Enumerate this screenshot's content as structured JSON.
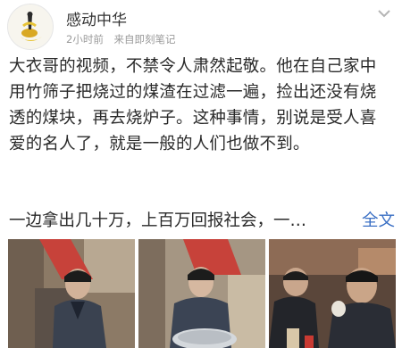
{
  "post": {
    "author": "感动中华",
    "time": "2小时前",
    "source": "来自即刻笔记",
    "paragraph": "大衣哥的视频，不禁令人肃然起敬。他在自己家中用竹筛子把烧过的煤渣在过滤一遍，捡出还没有烧透的煤块，再去烧炉子。这种事情，别说是受人喜爱的名人了，就是一般的人们也做不到。",
    "preview": "一边拿出几十万，上百万回报社会，一…",
    "full_text_link": "全文"
  },
  "icons": {
    "avatar": "avatar-icon",
    "menu": "chevron-down-icon"
  },
  "colors": {
    "link": "#3a6fc4",
    "meta": "#9a9a9a"
  }
}
